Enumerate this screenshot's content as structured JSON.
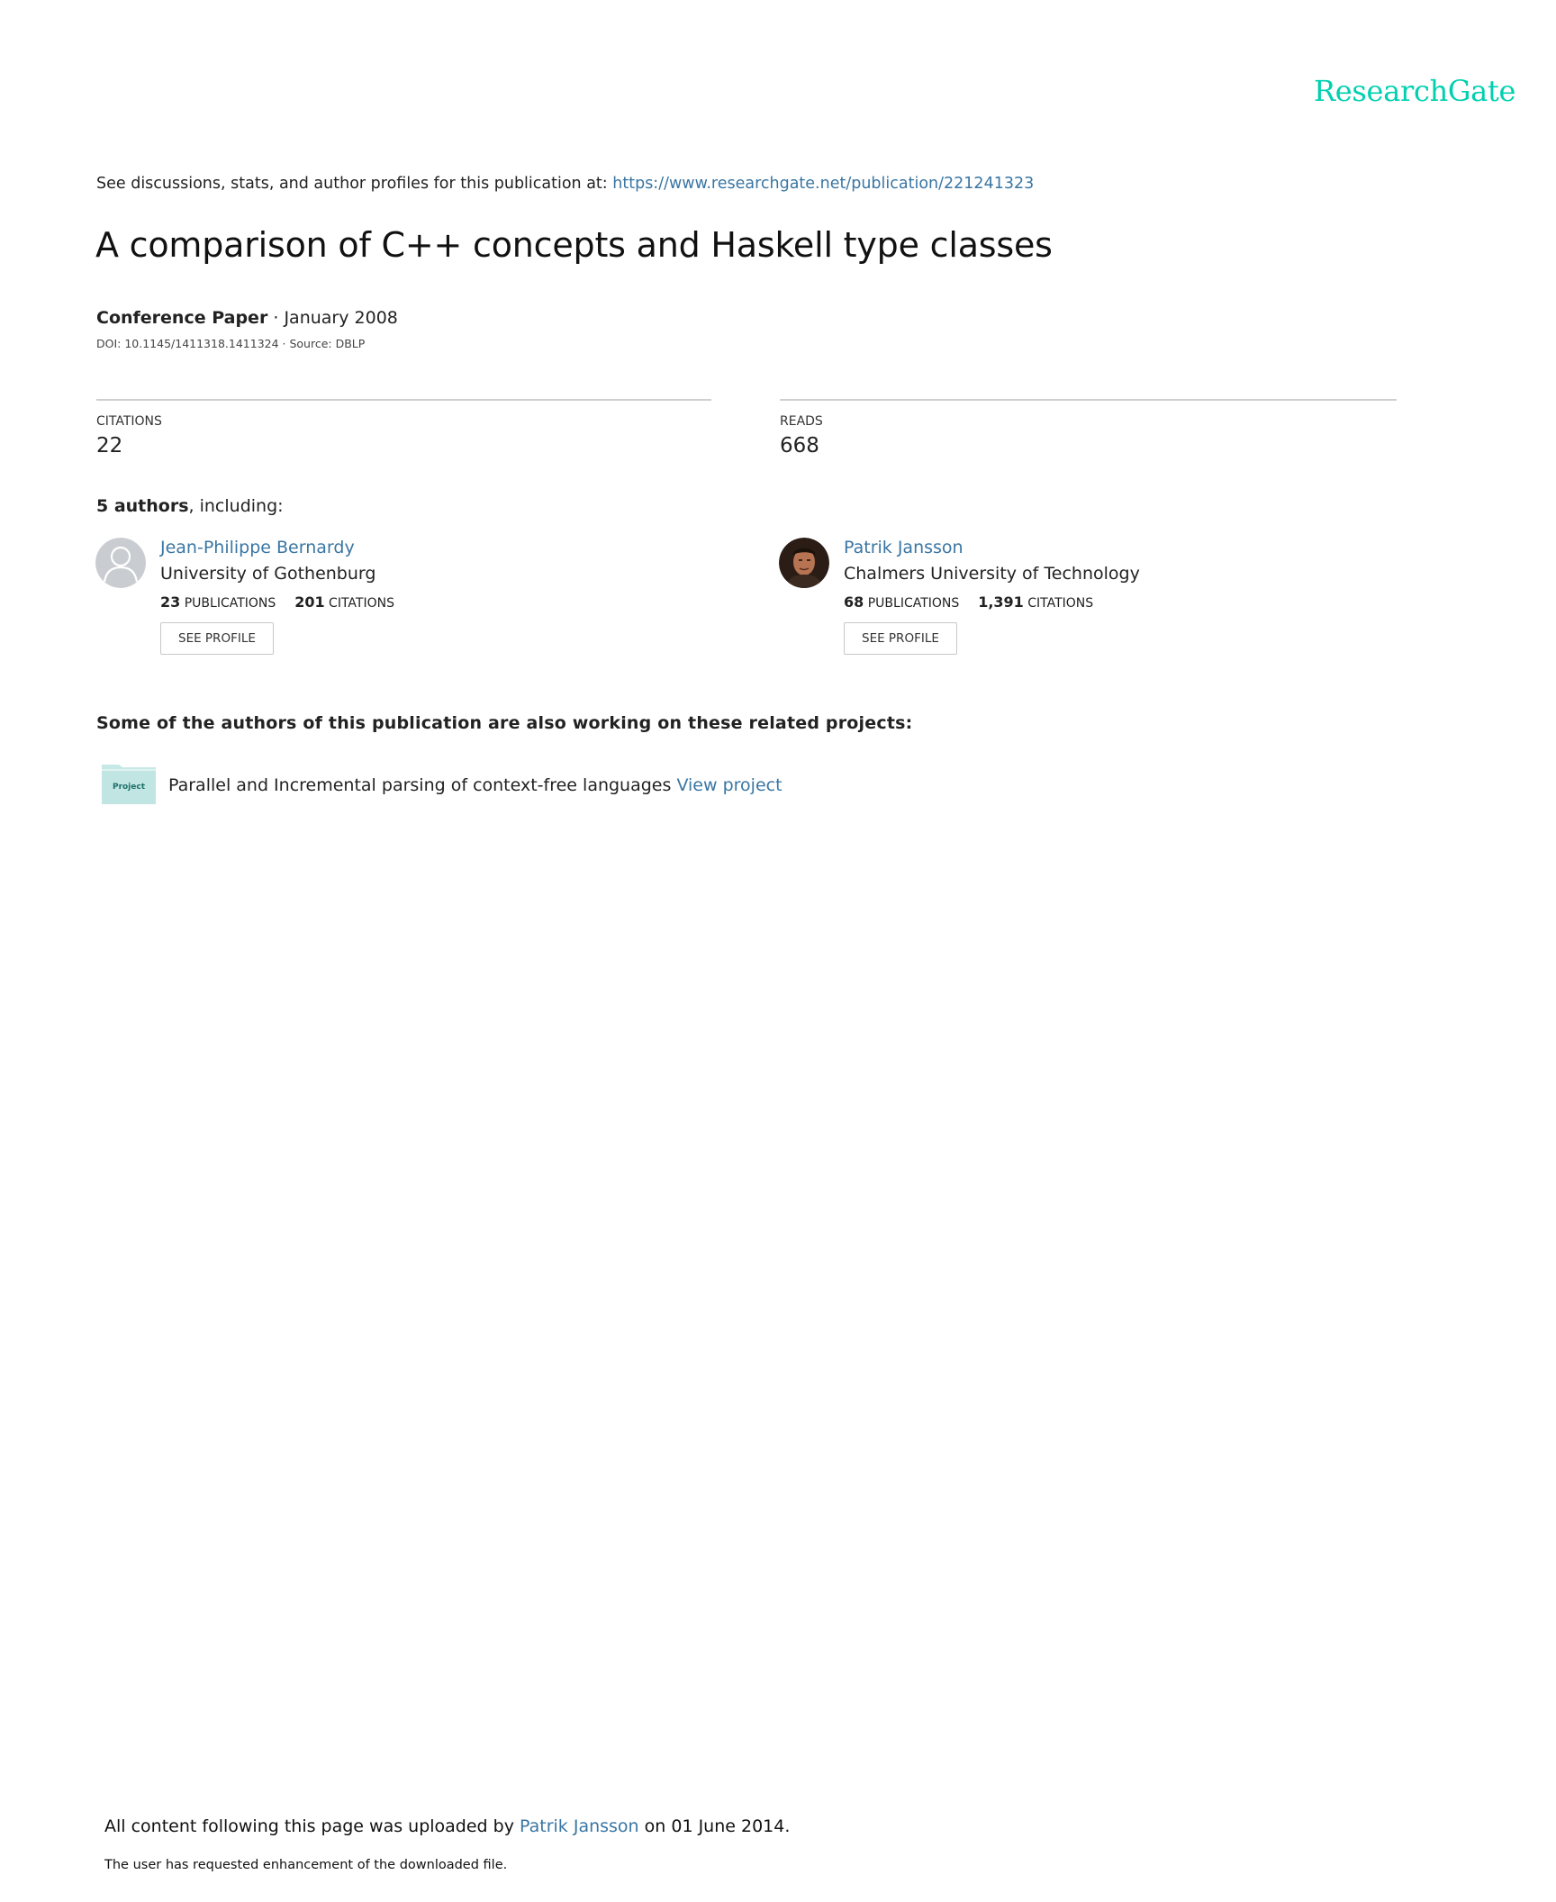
{
  "header": {
    "brand": "ResearchGate",
    "discussion_prefix": "See discussions, stats, and author profiles for this publication at: ",
    "publication_url": "https://www.researchgate.net/publication/221241323"
  },
  "publication": {
    "title": "A comparison of C++ concepts and Haskell type classes",
    "type": "Conference Paper",
    "date": " · January 2008",
    "doi_line": "DOI: 10.1145/1411318.1411324 · Source: DBLP"
  },
  "stats": {
    "citations_label": "CITATIONS",
    "citations_value": "22",
    "reads_label": "READS",
    "reads_value": "668"
  },
  "authors_section": {
    "count_bold": "5 authors",
    "suffix": ", including:",
    "publications_label": "PUBLICATIONS",
    "citations_label": "CITATIONS",
    "button_label": "SEE PROFILE",
    "authors": [
      {
        "name": "Jean-Philippe Bernardy",
        "institution": "University of Gothenburg",
        "publications": "23",
        "citations": "201",
        "avatar": "default-avatar-icon"
      },
      {
        "name": "Patrik Jansson",
        "institution": "Chalmers University of Technology",
        "publications": "68",
        "citations": "1,391",
        "avatar": "author-photo"
      }
    ]
  },
  "related": {
    "heading": "Some of the authors of this publication are also working on these related projects:",
    "icon_label": "Project",
    "project_title": "Parallel and Incremental parsing of context-free languages",
    "project_link": "View project"
  },
  "footer": {
    "uploaded_prefix": "All content following this page was uploaded by ",
    "uploader": "Patrik Jansson",
    "uploaded_suffix": " on 01 June 2014.",
    "requested": "The user has requested enhancement of the downloaded file."
  },
  "colors": {
    "brand": "#00d0af",
    "link": "#3a76a3",
    "rule": "#cfcfcf",
    "project_icon": "#c6e8e6"
  }
}
